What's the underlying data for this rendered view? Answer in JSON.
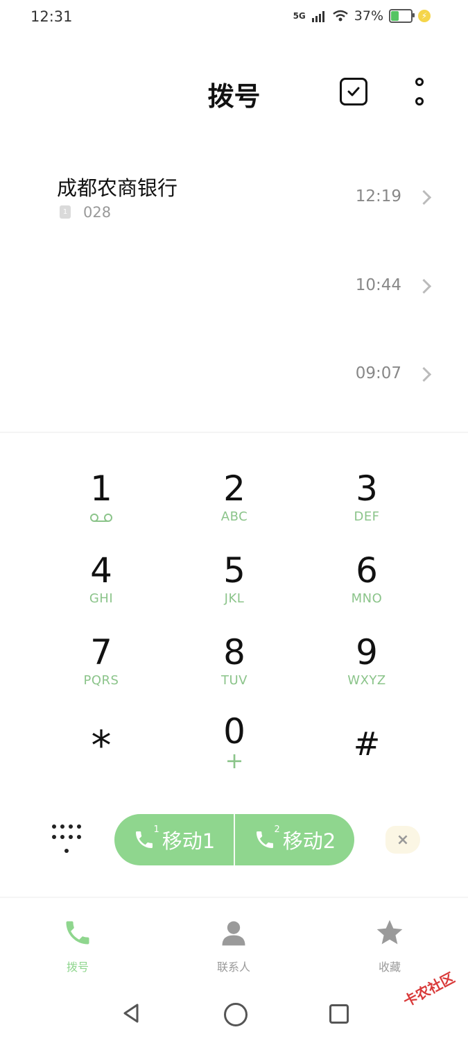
{
  "status_bar": {
    "time": "12:31",
    "network": "5G",
    "battery_percent": "37%",
    "battery_level": 0.37
  },
  "header": {
    "title": "拨号"
  },
  "call_log": [
    {
      "name": "成都农商银行",
      "sim": "1",
      "number": "028",
      "time": "12:19"
    },
    {
      "name": "",
      "sim": "",
      "number": "",
      "time": "10:44"
    },
    {
      "name": "",
      "sim": "",
      "number": "",
      "time": "09:07"
    }
  ],
  "keypad": [
    {
      "digit": "1",
      "letters": ""
    },
    {
      "digit": "2",
      "letters": "ABC"
    },
    {
      "digit": "3",
      "letters": "DEF"
    },
    {
      "digit": "4",
      "letters": "GHI"
    },
    {
      "digit": "5",
      "letters": "JKL"
    },
    {
      "digit": "6",
      "letters": "MNO"
    },
    {
      "digit": "7",
      "letters": "PQRS"
    },
    {
      "digit": "8",
      "letters": "TUV"
    },
    {
      "digit": "9",
      "letters": "WXYZ"
    },
    {
      "digit": "*",
      "letters": ""
    },
    {
      "digit": "0",
      "letters": "+"
    },
    {
      "digit": "#",
      "letters": ""
    }
  ],
  "call_buttons": [
    {
      "label": "移动1",
      "sim": "1"
    },
    {
      "label": "移动2",
      "sim": "2"
    }
  ],
  "delete_symbol": "×",
  "tabs": [
    {
      "label": "拨号",
      "icon": "phone-icon",
      "active": true
    },
    {
      "label": "联系人",
      "icon": "person-icon",
      "active": false
    },
    {
      "label": "收藏",
      "icon": "star-icon",
      "active": false
    }
  ],
  "watermark": "卡农社区",
  "colors": {
    "accent": "#8fd68e",
    "key_letters": "#8bc48a",
    "tab_inactive": "#9a9a9a"
  }
}
